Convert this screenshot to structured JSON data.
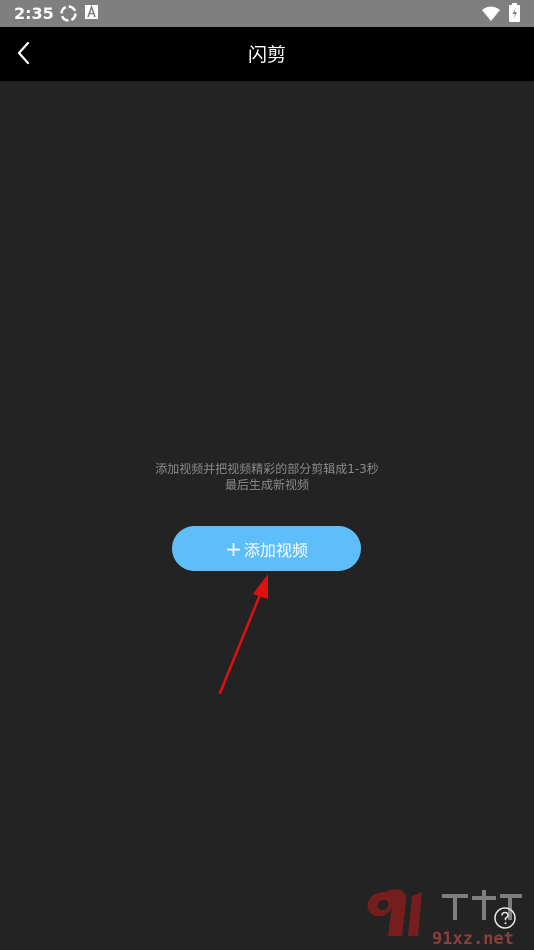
{
  "status_bar": {
    "time": "2:35",
    "icons": [
      "sync-icon",
      "font-a-icon",
      "wifi-icon",
      "battery-icon"
    ]
  },
  "app_bar": {
    "title": "闪剪",
    "back_icon": "chevron-left-icon"
  },
  "main": {
    "hint_line1": "添加视频并把视频精彩的部分剪辑成1-3秒",
    "hint_line2": "最后生成新视频",
    "add_button": {
      "plus": "+",
      "label": "添加视频"
    }
  },
  "watermark": {
    "brand": "91下载站",
    "site": "91xz.net"
  },
  "colors": {
    "accent": "#5ebef9",
    "background": "#232323",
    "app_bar": "#000000",
    "status_bar": "#7f7f7f",
    "annotation_arrow": "#e01010"
  }
}
